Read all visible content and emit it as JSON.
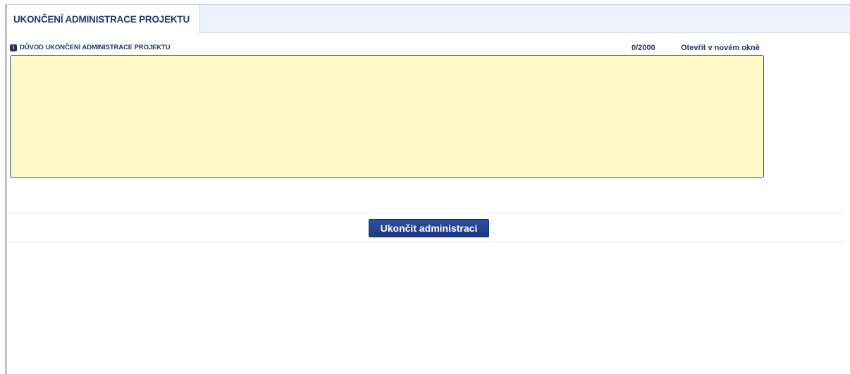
{
  "tab": {
    "label": "UKONČENÍ ADMINISTRACE PROJEKTU"
  },
  "field": {
    "info_icon_glyph": "i",
    "label": "DŮVOD UKONČENÍ ADMINISTRACE PROJEKTU",
    "counter": "0/2000",
    "open_link": "Otevřít v novém okně",
    "value": ""
  },
  "actions": {
    "finish_label": "Ukončit administraci"
  },
  "colors": {
    "accent": "#1f3a6e",
    "textarea_bg": "#fef9c6",
    "button_bg": "#24418c"
  }
}
